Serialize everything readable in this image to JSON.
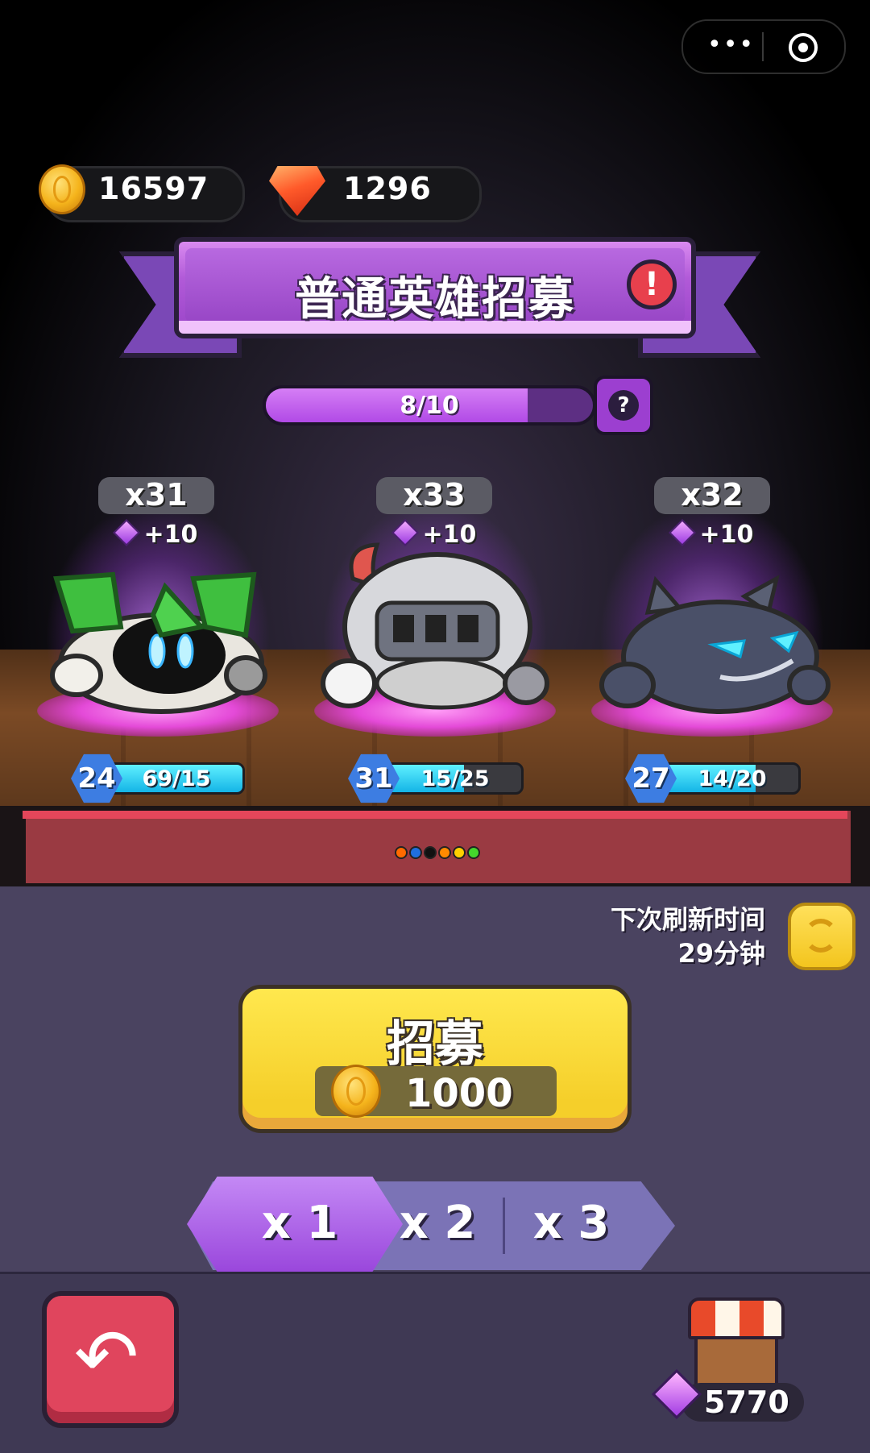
{
  "resources": {
    "coins": "16597",
    "gems": "1296"
  },
  "banner": {
    "title": "普通英雄招募",
    "alert_icon": "exclamation-icon",
    "alert_glyph": "!"
  },
  "progress": {
    "text": "8/10",
    "current": 8,
    "max": 10,
    "help_glyph": "?"
  },
  "heroes": [
    {
      "count": "x31",
      "bonus": "+10",
      "level": "24",
      "shards": "69/15",
      "fill": 1.0
    },
    {
      "count": "x33",
      "bonus": "+10",
      "level": "31",
      "shards": "15/25",
      "fill": 0.6
    },
    {
      "count": "x32",
      "bonus": "+10",
      "level": "27",
      "shards": "14/20",
      "fill": 0.7
    }
  ],
  "pager_dots": [
    "#ff6a00",
    "#1f6fe0",
    "#111111",
    "#ff8a00",
    "#ffd000",
    "#44d62c"
  ],
  "refresh": {
    "label": "下次刷新时间",
    "time": "29分钟"
  },
  "recruit": {
    "label": "招募",
    "cost": "1000"
  },
  "multipliers": {
    "options": [
      "x 1",
      "x 2",
      "x 3"
    ],
    "selected": "x 1"
  },
  "shop": {
    "gems": "5770"
  },
  "colors": {
    "accent_purple": "#9a47dc",
    "recruit_yellow": "#f5cf2a",
    "back_red": "#e0455d"
  }
}
